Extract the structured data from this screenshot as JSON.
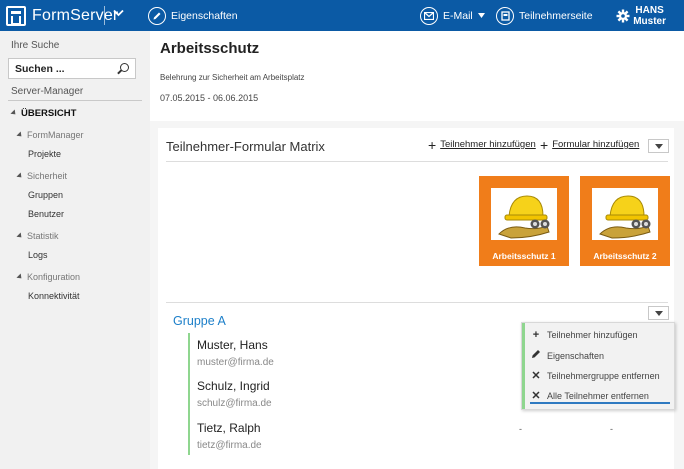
{
  "topbar": {
    "app_name": "FormServer",
    "properties_label": "Eigenschaften",
    "email_label": "E-Mail",
    "participant_page_label": "Teilnehmerseite",
    "user_first": "HANS",
    "user_last": "Muster",
    "accent_color": "#0b5aa5"
  },
  "sidebar": {
    "search_section": "Ihre Suche",
    "search_placeholder": "Suchen ...",
    "server_manager": "Server-Manager",
    "overview": "ÜBERSICHT",
    "groups": [
      {
        "label": "FormManager",
        "items": [
          "Projekte"
        ]
      },
      {
        "label": "Sicherheit",
        "items": [
          "Gruppen",
          "Benutzer"
        ]
      },
      {
        "label": "Statistik",
        "items": [
          "Logs"
        ]
      },
      {
        "label": "Konfiguration",
        "items": [
          "Konnektivität"
        ]
      }
    ]
  },
  "main": {
    "title": "Arbeitsschutz",
    "subtitle": "Belehrung zur Sicherheit am Arbeitsplatz",
    "dates": "07.05.2015 - 06.06.2015",
    "matrix_title": "Teilnehmer-Formular Matrix",
    "add_participant": "Teilnehmer hinzufügen",
    "add_form": "Formular hinzufügen",
    "forms": [
      "Arbeitsschutz  1",
      "Arbeitsschutz  2"
    ],
    "form_tile_color": "#f07d1a",
    "group_name": "Gruppe A",
    "participants": [
      {
        "name": "Muster, Hans",
        "email": "muster@firma.de"
      },
      {
        "name": "Schulz, Ingrid",
        "email": "schulz@firma.de"
      },
      {
        "name": "Tietz, Ralph",
        "email": "tietz@firma.de"
      }
    ],
    "cell_empty": "-"
  },
  "context_menu": {
    "items": [
      {
        "icon": "plus-icon",
        "label": "Teilnehmer hinzufügen"
      },
      {
        "icon": "pencil-icon",
        "label": "Eigenschaften"
      },
      {
        "icon": "close-icon",
        "label": "Teilnehmergruppe entfernen"
      },
      {
        "icon": "close-icon",
        "label": "Alle Teilnehmer entfernen"
      }
    ]
  }
}
